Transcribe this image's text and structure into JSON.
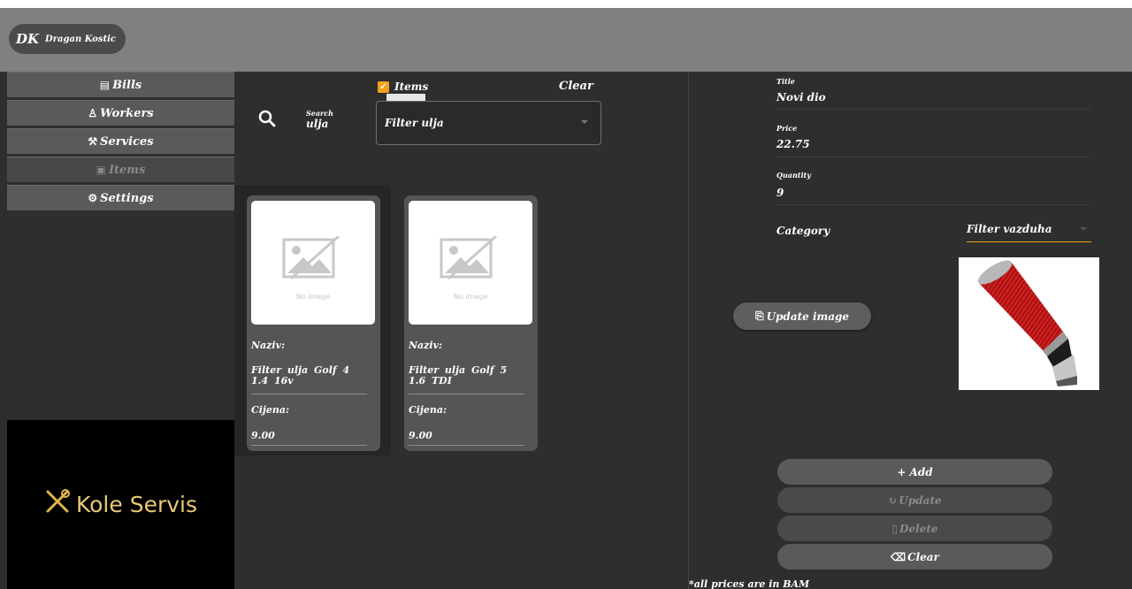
{
  "user": {
    "initials": "DK",
    "name": "Dragan Kostic"
  },
  "sidebar": {
    "items": [
      {
        "icon": "receipt-icon",
        "glyph": "▤",
        "label": "Bills",
        "disabled": false
      },
      {
        "icon": "worker-icon",
        "glyph": "♙",
        "label": "Workers",
        "disabled": false
      },
      {
        "icon": "wrench-icon",
        "glyph": "⚒",
        "label": "Services",
        "disabled": false
      },
      {
        "icon": "calendar-icon",
        "glyph": "▣",
        "label": "Items",
        "disabled": true
      },
      {
        "icon": "gear-icon",
        "glyph": "⚙",
        "label": "Settings",
        "disabled": false
      }
    ]
  },
  "brand": {
    "name": "Kole Servis",
    "icon": "tools-icon"
  },
  "search": {
    "label": "Search",
    "value": "ulja"
  },
  "filter": {
    "items_label": "Items",
    "items_checked": true,
    "clear_label": "Clear",
    "select_value": "Filter ulja"
  },
  "cards": [
    {
      "no_image": "No image",
      "name_label": "Naziv:",
      "name": "Filter ulja Golf 4 1.4 16v",
      "price_label": "Cijena:",
      "price": "9.00"
    },
    {
      "no_image": "No image",
      "name_label": "Naziv:",
      "name": "Filter ulja Golf 5 1.6 TDI",
      "price_label": "Cijena:",
      "price": "9.00"
    }
  ],
  "form": {
    "title_label": "Title",
    "title": "Novi dio",
    "price_label": "Price",
    "price": "22.75",
    "quantity_label": "Quantity",
    "quantity": "9",
    "category_label": "Category",
    "category": "Filter vazduha",
    "update_image": "Update image",
    "add": "+ Add",
    "update": "Update",
    "delete": "Delete",
    "clear": "Clear"
  },
  "note": "*all prices are in BAM",
  "colors": {
    "accent": "#f0a21c",
    "topbar": "#808080",
    "panel": "#2e2e2e",
    "brand": "#e8c877"
  }
}
